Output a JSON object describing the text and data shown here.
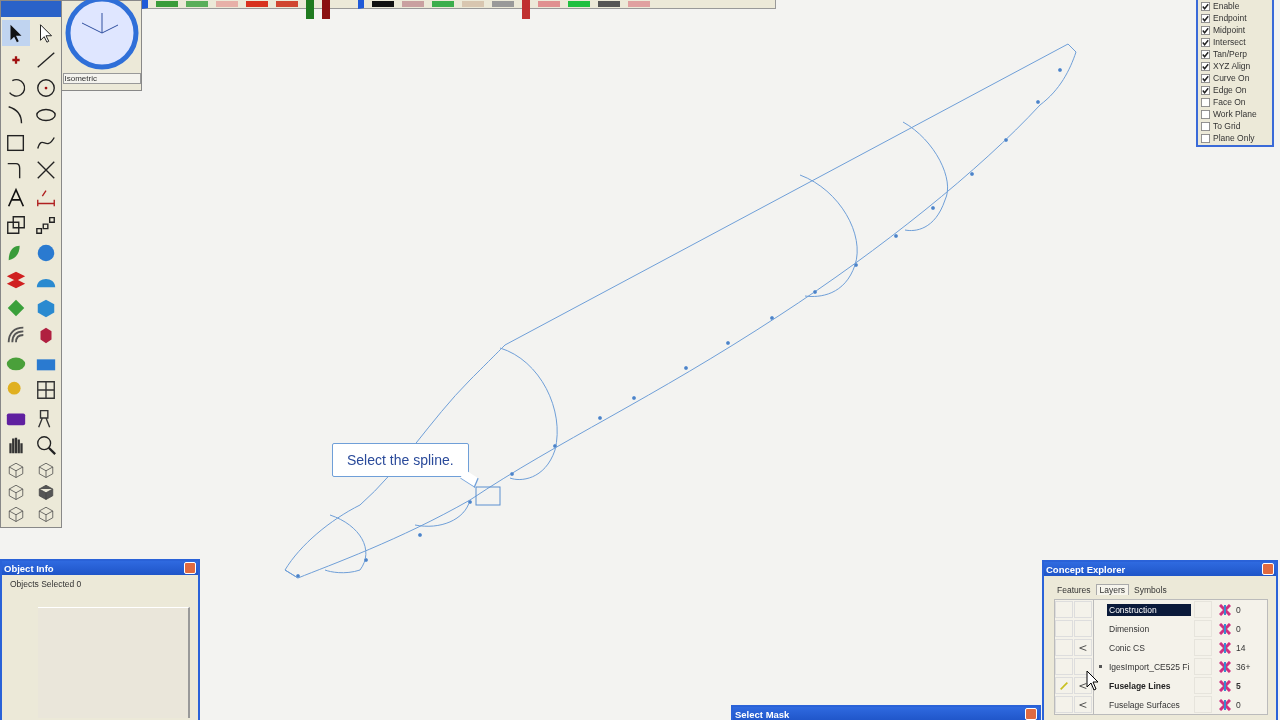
{
  "view": {
    "label": "Isometric"
  },
  "callout": {
    "text": "Select the spline."
  },
  "snaps": [
    {
      "label": "Enable",
      "checked": true
    },
    {
      "label": "Endpoint",
      "checked": true
    },
    {
      "label": "Midpoint",
      "checked": true
    },
    {
      "label": "Intersect",
      "checked": true
    },
    {
      "label": "Tan/Perp",
      "checked": true
    },
    {
      "label": "XYZ Align",
      "checked": true
    },
    {
      "label": "Curve On",
      "checked": true
    },
    {
      "label": "Edge On",
      "checked": true
    },
    {
      "label": "Face On",
      "checked": false
    },
    {
      "label": "Work Plane",
      "checked": false
    },
    {
      "label": "To Grid",
      "checked": false
    },
    {
      "label": "Plane Only",
      "checked": false
    }
  ],
  "object_info": {
    "title": "Object Info",
    "summary": "Objects Selected 0"
  },
  "concept_explorer": {
    "title": "Concept Explorer",
    "tabs": [
      {
        "label": "Features",
        "selected": false
      },
      {
        "label": "Layers",
        "selected": true
      },
      {
        "label": "Symbols",
        "selected": false
      }
    ],
    "layers": [
      {
        "name": "Construction",
        "count": "0",
        "selected": true,
        "active": false,
        "visible": false,
        "expandable": false
      },
      {
        "name": "Dimension",
        "count": "0",
        "selected": false,
        "active": false,
        "visible": false,
        "expandable": false
      },
      {
        "name": "Conic CS",
        "count": "14",
        "selected": false,
        "active": false,
        "visible": true,
        "expandable": false
      },
      {
        "name": "IgesImport_CE525 Fi",
        "count": "36+",
        "selected": false,
        "active": false,
        "visible": false,
        "expandable": true
      },
      {
        "name": "Fuselage Lines",
        "count": "5",
        "selected": false,
        "active": true,
        "visible": true,
        "expandable": false
      },
      {
        "name": "Fuselage Surfaces",
        "count": "0",
        "selected": false,
        "active": false,
        "visible": true,
        "expandable": false
      }
    ]
  },
  "select_mask": {
    "title": "Select Mask"
  }
}
